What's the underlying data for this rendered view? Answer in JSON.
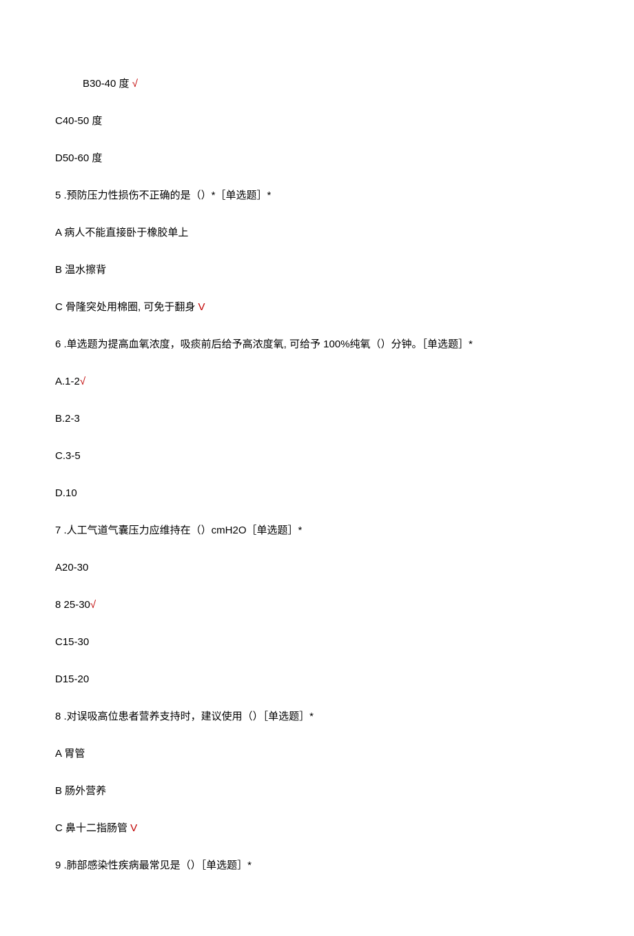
{
  "lines": [
    {
      "text": "B30-40 度",
      "indent": true,
      "hasCheck": true,
      "checkMark": " √"
    },
    {
      "text": "C40-50 度",
      "indent": false,
      "hasCheck": false
    },
    {
      "text": "D50-60 度",
      "indent": false,
      "hasCheck": false
    },
    {
      "text": "5   .预防压力性损伤不正确的是（）*［单选题］*",
      "indent": false,
      "hasCheck": false
    },
    {
      "text": "A 病人不能直接卧于橡胶单上",
      "indent": false,
      "hasCheck": false
    },
    {
      "text": "B 温水擦背",
      "indent": false,
      "hasCheck": false
    },
    {
      "text": "C 骨隆突处用棉圈, 可免于翻身",
      "indent": false,
      "hasCheck": true,
      "checkMark": " V"
    },
    {
      "text": "6   .单选题为提高血氧浓度，吸痰前后给予高浓度氧, 可给予 100%纯氧（）分钟。［单选题］*",
      "indent": false,
      "hasCheck": false
    },
    {
      "text": "A.1-2",
      "indent": false,
      "hasCheck": true,
      "checkMark": "√"
    },
    {
      "text": "B.2-3",
      "indent": false,
      "hasCheck": false
    },
    {
      "text": "C.3-5",
      "indent": false,
      "hasCheck": false
    },
    {
      "text": "D.10",
      "indent": false,
      "hasCheck": false
    },
    {
      "text": "7   .人工气道气囊压力应维持在（）cmH2O［单选题］*",
      "indent": false,
      "hasCheck": false
    },
    {
      "text": "A20-30",
      "indent": false,
      "hasCheck": false
    },
    {
      "text": "8   25-30",
      "indent": false,
      "hasCheck": true,
      "checkMark": "√"
    },
    {
      "text": "C15-30",
      "indent": false,
      "hasCheck": false
    },
    {
      "text": "D15-20",
      "indent": false,
      "hasCheck": false
    },
    {
      "text": "8   .对误吸高位患者营养支持时，建议使用（）［单选题］*",
      "indent": false,
      "hasCheck": false
    },
    {
      "text": "A 胃管",
      "indent": false,
      "hasCheck": false
    },
    {
      "text": "B 肠外营养",
      "indent": false,
      "hasCheck": false
    },
    {
      "text": "C 鼻十二指肠管",
      "indent": false,
      "hasCheck": true,
      "checkMark": " V"
    },
    {
      "text": "9   .肺部感染性疾病最常见是（）［单选题］*",
      "indent": false,
      "hasCheck": false
    }
  ]
}
